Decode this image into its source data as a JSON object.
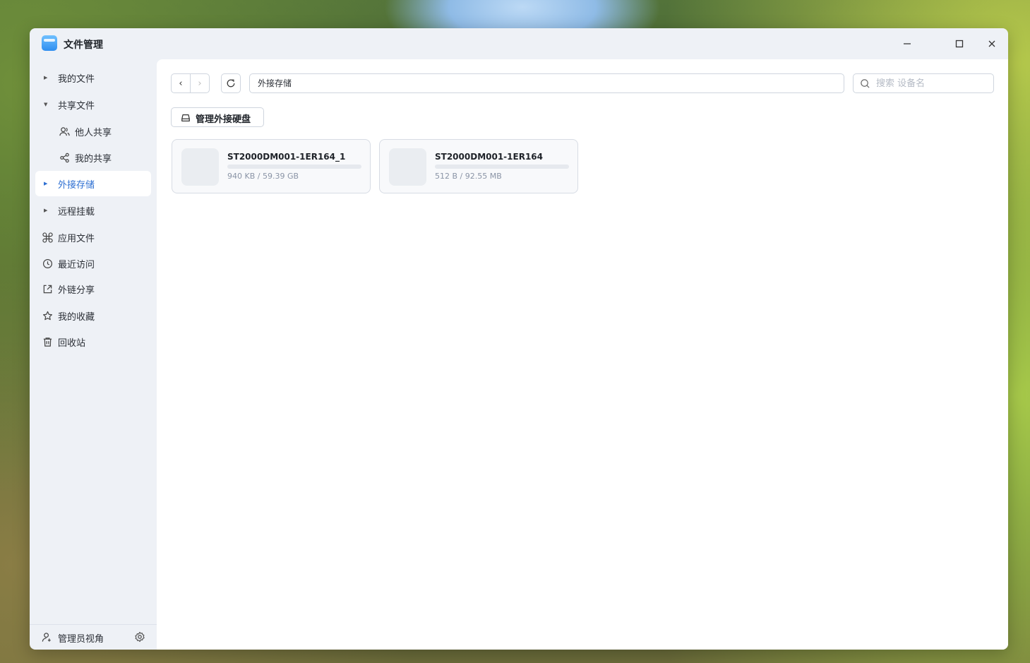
{
  "window": {
    "title": "文件管理"
  },
  "sidebar": {
    "items": [
      {
        "label": "我的文件",
        "icon": "caret-right-icon"
      },
      {
        "label": "共享文件",
        "icon": "caret-down-icon"
      },
      {
        "label": "他人共享",
        "icon": "users-icon"
      },
      {
        "label": "我的共享",
        "icon": "share-icon"
      },
      {
        "label": "外接存储",
        "icon": "caret-right-icon",
        "active": true
      },
      {
        "label": "远程挂载",
        "icon": "caret-right-icon"
      },
      {
        "label": "应用文件",
        "icon": "command-icon"
      },
      {
        "label": "最近访问",
        "icon": "clock-icon"
      },
      {
        "label": "外链分享",
        "icon": "external-share-icon"
      },
      {
        "label": "我的收藏",
        "icon": "star-icon"
      },
      {
        "label": "回收站",
        "icon": "trash-icon"
      }
    ],
    "footer": {
      "label": "管理员视角"
    }
  },
  "toolbar": {
    "path": "外接存储",
    "search_placeholder": "搜索 设备名"
  },
  "manage_button": {
    "label": "管理外接硬盘"
  },
  "devices": [
    {
      "name": "ST2000DM001-1ER164_1",
      "size": "940 KB / 59.39 GB",
      "usage": 0.0
    },
    {
      "name": "ST2000DM001-1ER164",
      "size": "512 B / 92.55 MB",
      "usage": 0.0
    }
  ],
  "colors": {
    "accent": "#2d6fd2",
    "sidebar_bg": "#eef1f6"
  }
}
